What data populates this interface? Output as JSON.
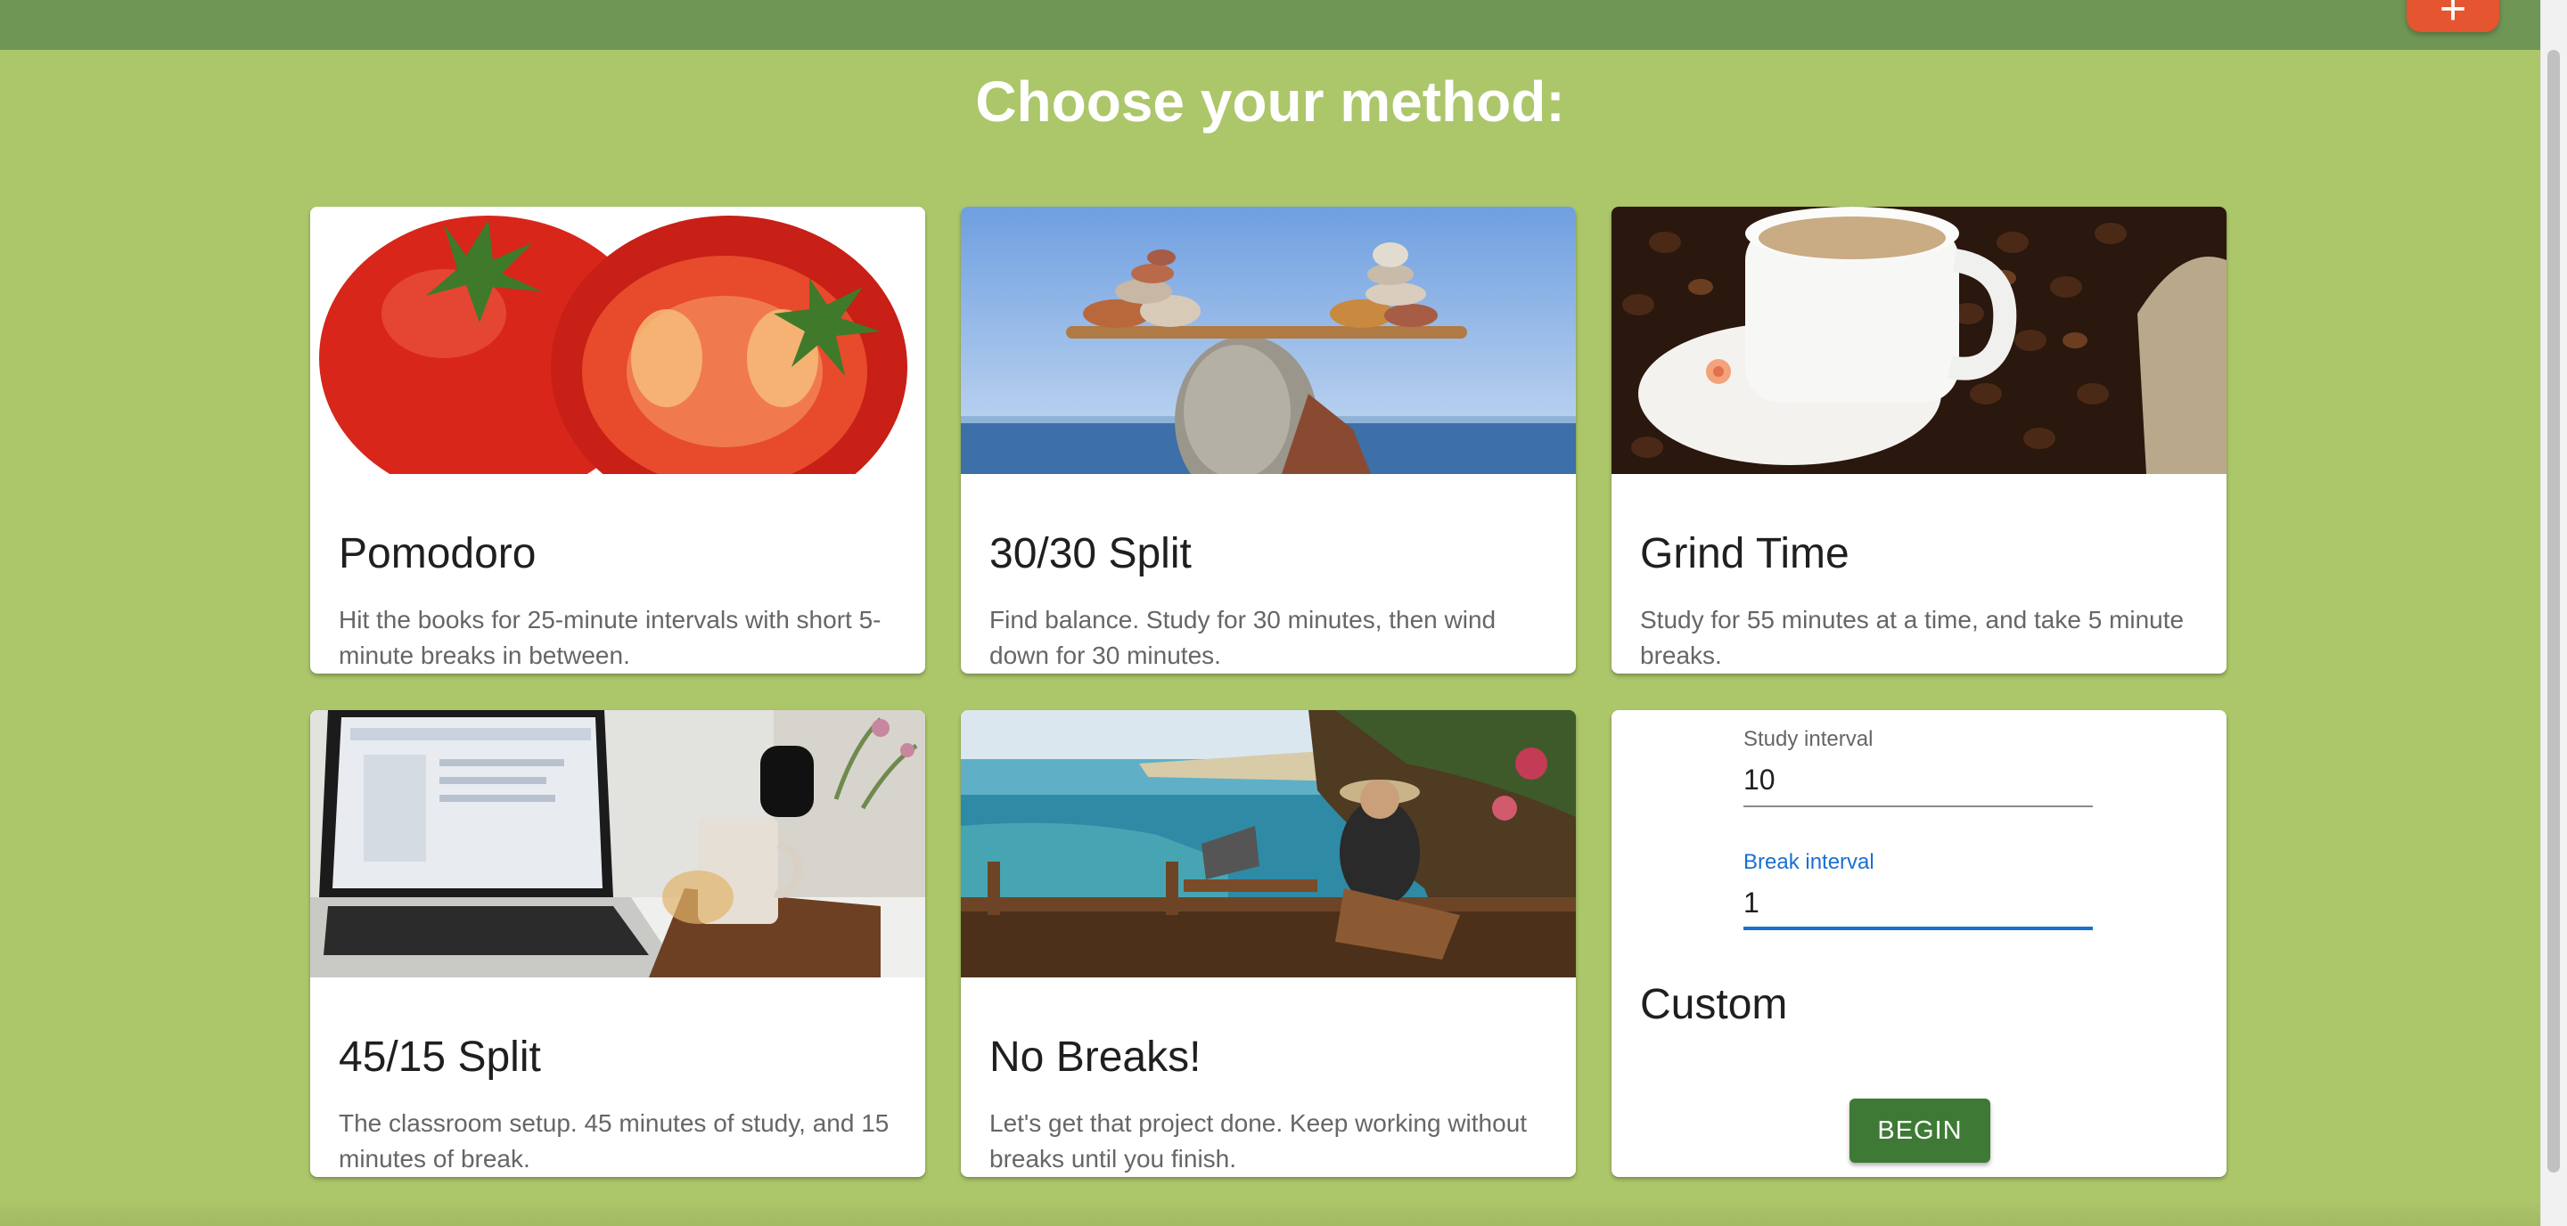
{
  "app": {
    "fab_label": "+",
    "page_title": "Choose your method:"
  },
  "methods": [
    {
      "title": "Pomodoro",
      "description": "Hit the books for 25-minute intervals with short 5-minute breaks in between.",
      "image": "tomato-image"
    },
    {
      "title": "30/30 Split",
      "description": "Find balance. Study for 30 minutes, then wind down for 30 minutes.",
      "image": "balanced-stones-image"
    },
    {
      "title": "Grind Time",
      "description": "Study for 55 minutes at a time, and take 5 minute breaks.",
      "image": "coffee-cup-image"
    },
    {
      "title": "45/15 Split",
      "description": "The classroom setup. 45 minutes of study, and 15 minutes of break.",
      "image": "laptop-desk-image"
    },
    {
      "title": "No Breaks!",
      "description": "Let's get that project done. Keep working without breaks until you finish.",
      "image": "ocean-workspace-image"
    }
  ],
  "custom": {
    "title": "Custom",
    "study_label": "Study interval",
    "study_value": "10",
    "break_label": "Break interval",
    "break_value": "1",
    "begin_label": "BEGIN"
  },
  "colors": {
    "background": "#acc66a",
    "topbar": "#6f9655",
    "fab": "#e5552f",
    "begin_button": "#3e7a35",
    "focus": "#1a6fd0"
  }
}
